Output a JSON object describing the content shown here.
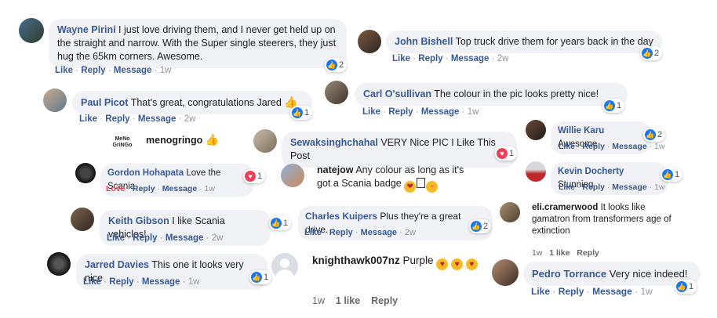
{
  "comments": {
    "wayne": {
      "name": "Wayne Pirini",
      "text": "I just love driving them, and I never get held up on the straight and narrow. With the Super single steerers, they just hug the 65km corners. Awesome.",
      "like": "Like",
      "reply": "Reply",
      "message": "Message",
      "time": "1w",
      "reactions": "2"
    },
    "john": {
      "name": "John Bishell",
      "text": "Top truck drive them for years back in the day",
      "like": "Like",
      "reply": "Reply",
      "message": "Message",
      "time": "2w",
      "reactions": "2"
    },
    "carl": {
      "name": "Carl O'sullivan",
      "text": "The colour in the pic looks pretty nice!",
      "like": "Like",
      "reply": "Reply",
      "message": "Message",
      "time": "1w",
      "reactions": "1"
    },
    "paul": {
      "name": "Paul Picot",
      "text": "That's great, congratulations Jared",
      "like": "Like",
      "reply": "Reply",
      "message": "Message",
      "time": "2w",
      "reactions": "1"
    },
    "willie": {
      "name": "Willie Karu",
      "text": "Awesome",
      "like": "Like",
      "reply": "Reply",
      "message": "Message",
      "time": "1w",
      "reactions": "2"
    },
    "menogringo": {
      "name": "menogringo",
      "avatar_text": "MeNo GriNGo"
    },
    "sewak": {
      "name": "Sewaksinghchahal",
      "text": "VERY Nice PIC I Like This Post",
      "reactions": "1"
    },
    "gordon": {
      "name": "Gordon Hohapata",
      "text": "Love the Scania",
      "love": "Love",
      "reply": "Reply",
      "message": "Message",
      "time": "1w",
      "reactions": "1"
    },
    "natejow": {
      "name": "natejow",
      "text": "Any colour as long as it's got a Scania badge"
    },
    "kevin": {
      "name": "Kevin Docherty",
      "text": "Stunning",
      "like": "Like",
      "reply": "Reply",
      "message": "Message",
      "time": "1w",
      "reactions": "1"
    },
    "keith": {
      "name": "Keith Gibson",
      "text": "I like Scania vehicles!",
      "like": "Like",
      "reply": "Reply",
      "message": "Message",
      "time": "2w",
      "reactions": "1"
    },
    "charles": {
      "name": "Charles Kuipers",
      "text": "Plus they're a great drive.",
      "like": "Like",
      "reply": "Reply",
      "message": "Message",
      "time": "2w",
      "reactions": "2"
    },
    "eli": {
      "name": "eli.cramerwood",
      "text": "It looks like gamatron from transformers age of extinction",
      "time": "1w",
      "likes": "1 like",
      "reply": "Reply"
    },
    "jarred": {
      "name": "Jarred Davies",
      "text": "This one it looks very nice",
      "like": "Like",
      "reply": "Reply",
      "message": "Message",
      "time": "1w",
      "reactions": "1"
    },
    "knighthawk": {
      "name": "knighthawk007nz",
      "text": "Purple",
      "time": "1w",
      "likes": "1 like",
      "reply": "Reply"
    },
    "pedro": {
      "name": "Pedro Torrance",
      "text": "Very nice indeed!",
      "like": "Like",
      "reply": "Reply",
      "message": "Message",
      "time": "1w",
      "reactions": "1"
    }
  },
  "separator": "·",
  "colors": {
    "link": "#385898",
    "bubble": "#f0f2f5",
    "like_blue": "#1877f2",
    "love_red": "#f33e58",
    "meta_gray": "#90949c"
  }
}
